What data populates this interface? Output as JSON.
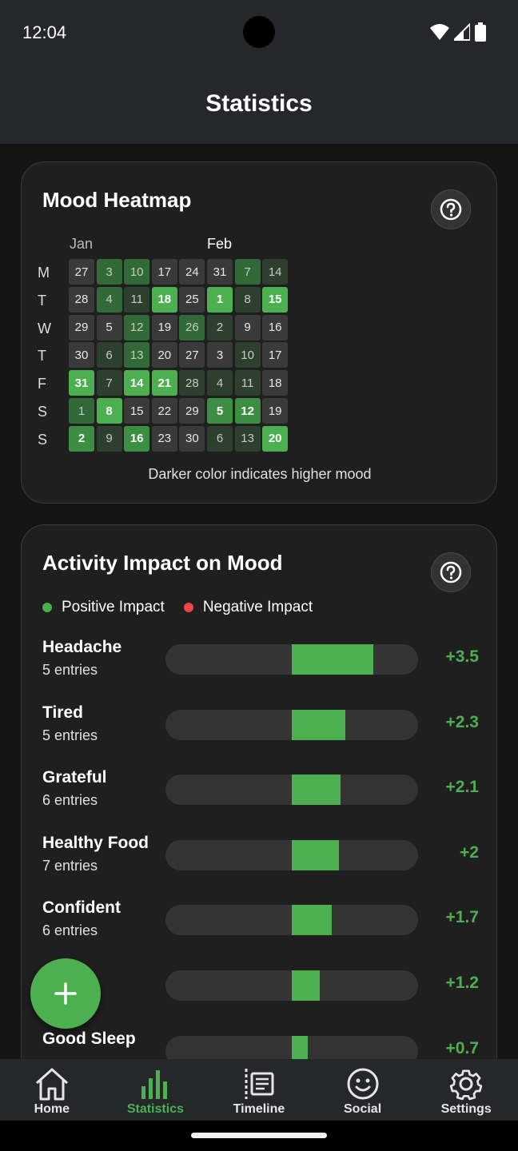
{
  "status_bar": {
    "time": "12:04"
  },
  "app_bar": {
    "title": "Statistics"
  },
  "heatmap": {
    "title": "Mood Heatmap",
    "months": [
      "Jan",
      "Feb"
    ],
    "day_letters": [
      "M",
      "T",
      "W",
      "T",
      "F",
      "S",
      "S"
    ],
    "columns": [
      [
        {
          "d": "27",
          "lvl": 0
        },
        {
          "d": "28",
          "lvl": 0
        },
        {
          "d": "29",
          "lvl": 0
        },
        {
          "d": "30",
          "lvl": 0
        },
        {
          "d": "31",
          "lvl": 4
        },
        {
          "d": "1",
          "lvl": 2
        },
        {
          "d": "2",
          "lvl": 3
        }
      ],
      [
        {
          "d": "3",
          "lvl": 2
        },
        {
          "d": "4",
          "lvl": 2
        },
        {
          "d": "5",
          "lvl": 0
        },
        {
          "d": "6",
          "lvl": 1
        },
        {
          "d": "7",
          "lvl": 1
        },
        {
          "d": "8",
          "lvl": 4
        },
        {
          "d": "9",
          "lvl": 1
        }
      ],
      [
        {
          "d": "10",
          "lvl": 2
        },
        {
          "d": "11",
          "lvl": 1
        },
        {
          "d": "12",
          "lvl": 2
        },
        {
          "d": "13",
          "lvl": 2
        },
        {
          "d": "14",
          "lvl": 4
        },
        {
          "d": "15",
          "lvl": 0
        },
        {
          "d": "16",
          "lvl": 3
        }
      ],
      [
        {
          "d": "17",
          "lvl": 0
        },
        {
          "d": "18",
          "lvl": 4
        },
        {
          "d": "19",
          "lvl": 0
        },
        {
          "d": "20",
          "lvl": 0
        },
        {
          "d": "21",
          "lvl": 4
        },
        {
          "d": "22",
          "lvl": 0
        },
        {
          "d": "23",
          "lvl": 0
        }
      ],
      [
        {
          "d": "24",
          "lvl": 0
        },
        {
          "d": "25",
          "lvl": 0
        },
        {
          "d": "26",
          "lvl": 2
        },
        {
          "d": "27",
          "lvl": 0
        },
        {
          "d": "28",
          "lvl": 1
        },
        {
          "d": "29",
          "lvl": 0
        },
        {
          "d": "30",
          "lvl": 0
        }
      ],
      [
        {
          "d": "31",
          "lvl": 0
        },
        {
          "d": "1",
          "lvl": 4
        },
        {
          "d": "2",
          "lvl": 1
        },
        {
          "d": "3",
          "lvl": 0
        },
        {
          "d": "4",
          "lvl": 1
        },
        {
          "d": "5",
          "lvl": 3
        },
        {
          "d": "6",
          "lvl": 1
        }
      ],
      [
        {
          "d": "7",
          "lvl": 2
        },
        {
          "d": "8",
          "lvl": 1
        },
        {
          "d": "9",
          "lvl": 0
        },
        {
          "d": "10",
          "lvl": 1
        },
        {
          "d": "11",
          "lvl": 1
        },
        {
          "d": "12",
          "lvl": 3
        },
        {
          "d": "13",
          "lvl": 1
        }
      ],
      [
        {
          "d": "14",
          "lvl": 1
        },
        {
          "d": "15",
          "lvl": 4
        },
        {
          "d": "16",
          "lvl": 0
        },
        {
          "d": "17",
          "lvl": 0
        },
        {
          "d": "18",
          "lvl": 0
        },
        {
          "d": "19",
          "lvl": 0
        },
        {
          "d": "20",
          "lvl": 4
        }
      ]
    ],
    "caption": "Darker color indicates higher mood"
  },
  "activity": {
    "title": "Activity Impact on Mood",
    "legend": {
      "positive_label": "Positive Impact",
      "negative_label": "Negative Impact",
      "positive_color": "#4caf50",
      "negative_color": "#f04444"
    },
    "items": [
      {
        "name": "Headache",
        "count": "5 entries",
        "value": "+3.5",
        "impact": 3.5
      },
      {
        "name": "Tired",
        "count": "5 entries",
        "value": "+2.3",
        "impact": 2.3
      },
      {
        "name": "Grateful",
        "count": "6 entries",
        "value": "+2.1",
        "impact": 2.1
      },
      {
        "name": "Healthy Food",
        "count": "7 entries",
        "value": "+2",
        "impact": 2.0
      },
      {
        "name": "Confident",
        "count": "6 entries",
        "value": "+1.7",
        "impact": 1.7
      },
      {
        "name": "",
        "count": "",
        "value": "+1.2",
        "impact": 1.2
      },
      {
        "name": "Good Sleep",
        "count": "",
        "value": "+0.7",
        "impact": 0.7
      }
    ],
    "max_impact": 5.4
  },
  "fab": {
    "icon": "plus-icon"
  },
  "bottom_nav": {
    "items": [
      {
        "label": "Home",
        "icon": "home-icon",
        "active": false
      },
      {
        "label": "Statistics",
        "icon": "bar-chart-icon",
        "active": true
      },
      {
        "label": "Timeline",
        "icon": "timeline-icon",
        "active": false
      },
      {
        "label": "Social",
        "icon": "smiley-icon",
        "active": false
      },
      {
        "label": "Settings",
        "icon": "gear-icon",
        "active": false
      }
    ],
    "active_color": "#4caf50",
    "inactive_color": "#e6e6e6"
  }
}
